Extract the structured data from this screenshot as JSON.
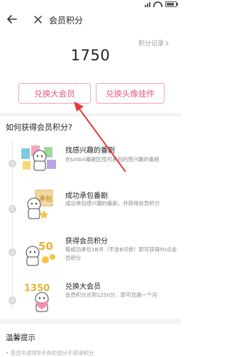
{
  "status_bar": {
    "battery_level": 0.8
  },
  "header": {
    "title": "会员积分"
  },
  "records_link": "积分记录",
  "points": "1750",
  "buttons": {
    "exchange_vip": "兑换大会员",
    "exchange_pendant": "兑换头像挂件"
  },
  "how_to": {
    "title": "如何获得会员积分?",
    "steps": [
      {
        "number": "1",
        "title": "找感兴趣的番剧",
        "desc": "在bilibili番剧区找可承包的感兴趣的番剧"
      },
      {
        "number": "2",
        "title": "成功承包番剧",
        "desc": "成功承包感兴趣的番剧，并获得会员积分"
      },
      {
        "number": "3",
        "title": "获得会员积分",
        "desc": "每成功承包1B币（不含B币券）即可获得50点会员积分"
      },
      {
        "number": "4",
        "title": "兑换大会员",
        "desc": "会员积分达到1250分，即可兑换一个月"
      }
    ]
  },
  "tips": {
    "title": "温馨提示",
    "line1": "• 若您中途将B币券的部分不获得积分"
  },
  "colors": {
    "accent": "#e9587c",
    "annotation_arrow": "#e53935"
  },
  "icons": {
    "back": "arrow-left-icon",
    "close": "close-icon",
    "records": "chevron-right-icon"
  }
}
